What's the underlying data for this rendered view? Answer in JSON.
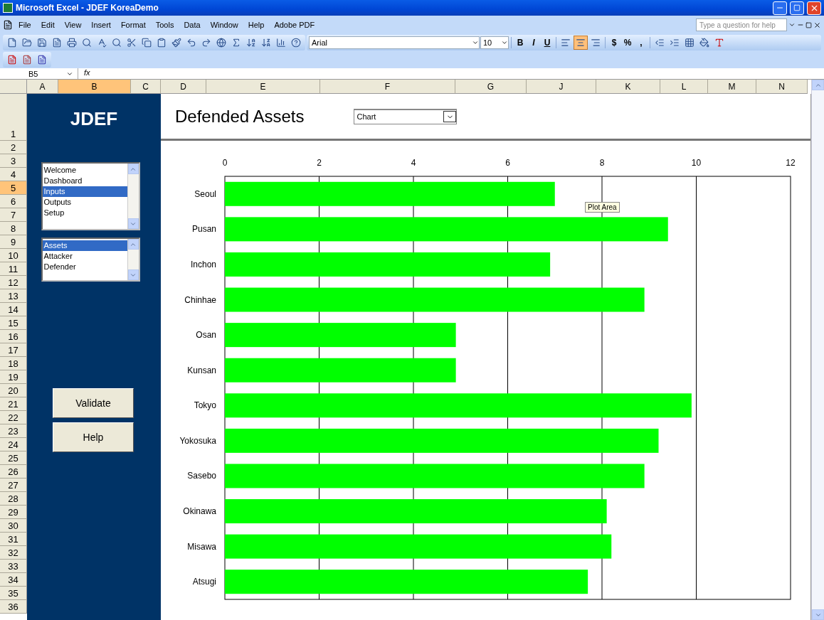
{
  "window": {
    "title": "Microsoft Excel - JDEF KoreaDemo"
  },
  "menu": [
    "File",
    "Edit",
    "View",
    "Insert",
    "Format",
    "Tools",
    "Data",
    "Window",
    "Help",
    "Adobe PDF"
  ],
  "help_search": {
    "placeholder": "Type a question for help"
  },
  "formatting": {
    "font": "Arial",
    "size": "10",
    "styles": [
      "B",
      "I",
      "U"
    ],
    "align_buttons": [
      {
        "kind": "left",
        "selected": false
      },
      {
        "kind": "center",
        "selected": true
      },
      {
        "kind": "right",
        "selected": false
      }
    ],
    "number_buttons": [
      "$",
      "%",
      ","
    ]
  },
  "formula_bar": {
    "name_box": "B5",
    "fx": "fx"
  },
  "columns": [
    {
      "label": "A",
      "selected": false
    },
    {
      "label": "B",
      "selected": true
    },
    {
      "label": "C",
      "selected": false
    },
    {
      "label": "D",
      "selected": false
    },
    {
      "label": "E",
      "selected": false
    },
    {
      "label": "F",
      "selected": false
    },
    {
      "label": "G",
      "selected": false
    },
    {
      "label": "J",
      "selected": false
    },
    {
      "label": "K",
      "selected": false
    },
    {
      "label": "L",
      "selected": false
    },
    {
      "label": "M",
      "selected": false
    },
    {
      "label": "N",
      "selected": false
    }
  ],
  "rows": [
    {
      "label": "1",
      "selected": false
    },
    {
      "label": "2",
      "selected": false
    },
    {
      "label": "3",
      "selected": false
    },
    {
      "label": "4",
      "selected": false
    },
    {
      "label": "5",
      "selected": true
    },
    {
      "label": "6",
      "selected": false
    },
    {
      "label": "7",
      "selected": false
    },
    {
      "label": "8",
      "selected": false
    },
    {
      "label": "9",
      "selected": false
    },
    {
      "label": "10",
      "selected": false
    },
    {
      "label": "11",
      "selected": false
    },
    {
      "label": "12",
      "selected": false
    },
    {
      "label": "13",
      "selected": false
    },
    {
      "label": "14",
      "selected": false
    },
    {
      "label": "15",
      "selected": false
    },
    {
      "label": "16",
      "selected": false
    },
    {
      "label": "17",
      "selected": false
    },
    {
      "label": "18",
      "selected": false
    },
    {
      "label": "19",
      "selected": false
    },
    {
      "label": "20",
      "selected": false
    },
    {
      "label": "21",
      "selected": false
    },
    {
      "label": "22",
      "selected": false
    },
    {
      "label": "23",
      "selected": false
    },
    {
      "label": "24",
      "selected": false
    },
    {
      "label": "25",
      "selected": false
    },
    {
      "label": "26",
      "selected": false
    },
    {
      "label": "27",
      "selected": false
    },
    {
      "label": "28",
      "selected": false
    },
    {
      "label": "29",
      "selected": false
    },
    {
      "label": "30",
      "selected": false
    },
    {
      "label": "31",
      "selected": false
    },
    {
      "label": "32",
      "selected": false
    },
    {
      "label": "33",
      "selected": false
    },
    {
      "label": "34",
      "selected": false
    },
    {
      "label": "35",
      "selected": false
    },
    {
      "label": "36",
      "selected": false
    }
  ],
  "sidebar": {
    "logo": "JDEF",
    "nav_list": [
      {
        "label": "Welcome",
        "selected": false
      },
      {
        "label": "Dashboard",
        "selected": false
      },
      {
        "label": "Inputs",
        "selected": true
      },
      {
        "label": "Outputs",
        "selected": false
      },
      {
        "label": "Setup",
        "selected": false
      }
    ],
    "section_list": [
      {
        "label": "Assets",
        "selected": true
      },
      {
        "label": "Attacker",
        "selected": false
      },
      {
        "label": "Defender",
        "selected": false
      }
    ],
    "buttons": [
      "Validate",
      "Help"
    ]
  },
  "main": {
    "title": "Defended Assets",
    "view_select": {
      "value": "Chart"
    },
    "tooltip": "Plot Area",
    "chart_data": {
      "type": "bar",
      "orientation": "horizontal",
      "grid": true,
      "xlim": [
        0,
        12
      ],
      "xticks": [
        0,
        2,
        4,
        6,
        8,
        10,
        12
      ],
      "categories": [
        "Seoul",
        "Pusan",
        "Inchon",
        "Chinhae",
        "Osan",
        "Kunsan",
        "Tokyo",
        "Yokosuka",
        "Sasebo",
        "Okinawa",
        "Misawa",
        "Atsugi"
      ],
      "series": [
        {
          "color": "#00ff00",
          "values": [
            7.0,
            9.4,
            6.9,
            8.9,
            4.9,
            4.9,
            9.9,
            9.2,
            8.9,
            8.1,
            8.2,
            7.7
          ]
        }
      ]
    }
  }
}
